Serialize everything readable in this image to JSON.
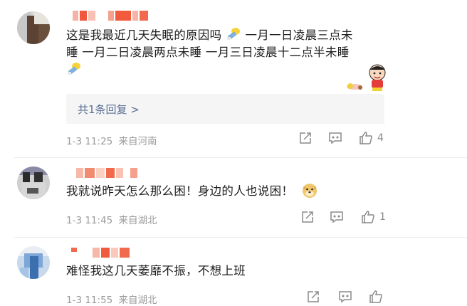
{
  "comments": [
    {
      "text_line1": "这是我最近几天失眠的原因吗",
      "text_line1b": "一月一日凌晨三点未",
      "text_line2": "睡 一月二日凌晨两点未睡 一月三日凌晨十二点半未睡",
      "reply_link": "共1条回复 >",
      "time": "1-3 11:25",
      "location": "来自河南",
      "like_count": "4"
    },
    {
      "text": "我就说昨天怎么那么困！身边的人也说困！",
      "time": "1-3 11:45",
      "location": "来自湖北",
      "like_count": "1"
    },
    {
      "text": "难怪我这几天萎靡不振，不想上班",
      "time": "1-3 11:55",
      "location": "来自湖北"
    }
  ],
  "icons": {
    "share": "share-icon",
    "comment": "comment-icon",
    "like": "thumb-up-icon",
    "sticker_rocket": "rocket-sticker-icon",
    "sticker_crayon": "crayon-shinchan-sticker-icon",
    "sticker_doge": "doge-emoji-icon"
  },
  "colors": {
    "link": "#5a6f95",
    "meta": "#9a9a9a",
    "reply_bg": "#f5f5f5"
  }
}
